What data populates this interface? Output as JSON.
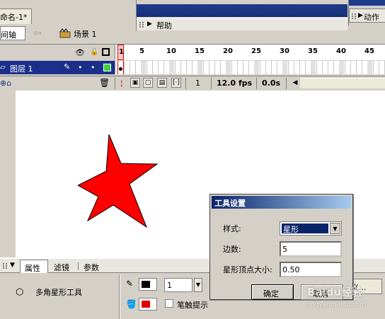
{
  "document": {
    "tab_title": "命名-1*"
  },
  "timeline_toolbar": {
    "timeline_label": "间轴",
    "scene_label": "场景 1"
  },
  "panels": {
    "help_label": "帮助",
    "actions_label": "动作"
  },
  "timeline": {
    "ticks": [
      "1",
      "5",
      "10",
      "15",
      "20",
      "25",
      "30",
      "35",
      "40",
      "45"
    ],
    "layer_name": "图层 1",
    "current_frame": "1",
    "frame_rate": "12.0 fps",
    "elapsed_time": "0.0s"
  },
  "property_panel": {
    "tabs": [
      "属性",
      "滤镜",
      "参数"
    ],
    "tool_name": "多角星形工具",
    "stroke_width": "1",
    "stroke_hint_label": "笔触提示",
    "options_label": "义..."
  },
  "dialog": {
    "title": "工具设置",
    "style_label": "样式:",
    "style_value": "星形",
    "sides_label": "边数:",
    "sides_value": "5",
    "vertex_label": "星形顶点大小:",
    "vertex_value": "0.50",
    "ok_label": "确定",
    "cancel_label": "取消"
  },
  "colors": {
    "star_fill": "#ff0000",
    "fill_color": "#e00000",
    "stroke_color": "#000000",
    "layer_highlight": "#1c2f8a"
  },
  "watermark": {
    "main": "Baidu经验",
    "sub": "jingyan.baidu.com"
  }
}
